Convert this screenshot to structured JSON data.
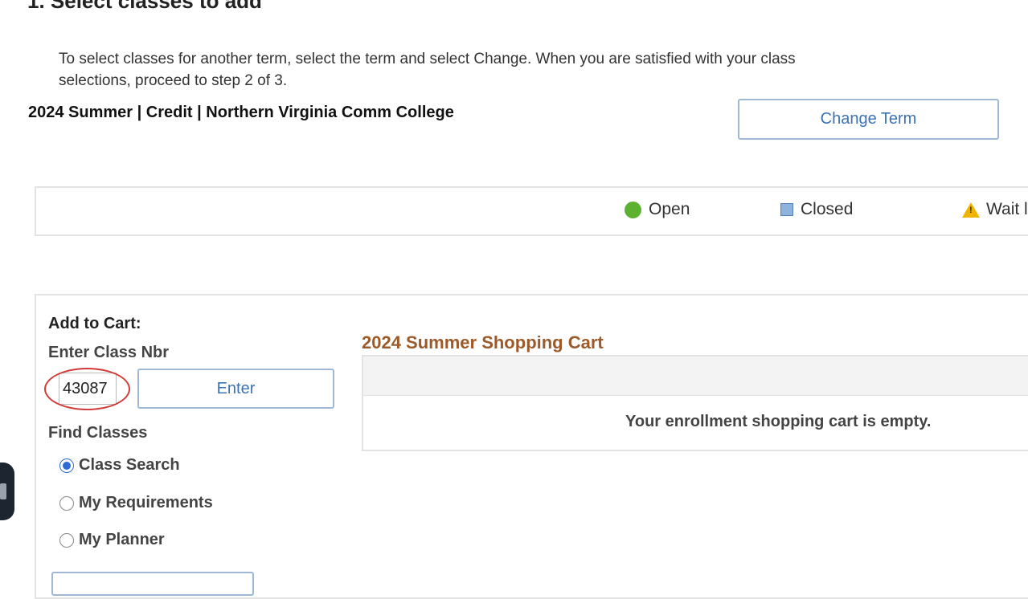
{
  "page": {
    "heading": "1.  Select classes to add",
    "instructions": "To select classes for another term, select the term and select Change.  When you are satisfied with your class selections, proceed to step 2 of 3.",
    "term_info": "2024 Summer | Credit | Northern Virginia Comm College",
    "change_term_label": "Change Term"
  },
  "legend": {
    "open": "Open",
    "closed": "Closed",
    "wait": "Wait l"
  },
  "add_to_cart": {
    "title": "Add to Cart:",
    "enter_class_nbr_label": "Enter Class Nbr",
    "class_nbr_value": "43087",
    "enter_label": "Enter",
    "find_classes_label": "Find Classes",
    "options": [
      {
        "label": "Class Search",
        "checked": true
      },
      {
        "label": "My Requirements",
        "checked": false
      },
      {
        "label": "My Planner",
        "checked": false
      }
    ]
  },
  "cart": {
    "title": "2024 Summer Shopping Cart",
    "empty_message": "Your enrollment shopping cart is empty."
  },
  "colors": {
    "open": "#5cb131",
    "closed": "#8fb3dd",
    "wait": "#f0b400",
    "button_text": "#3c73b4",
    "cart_title": "#9c5a2a",
    "highlight_ring": "#d23a3a"
  }
}
